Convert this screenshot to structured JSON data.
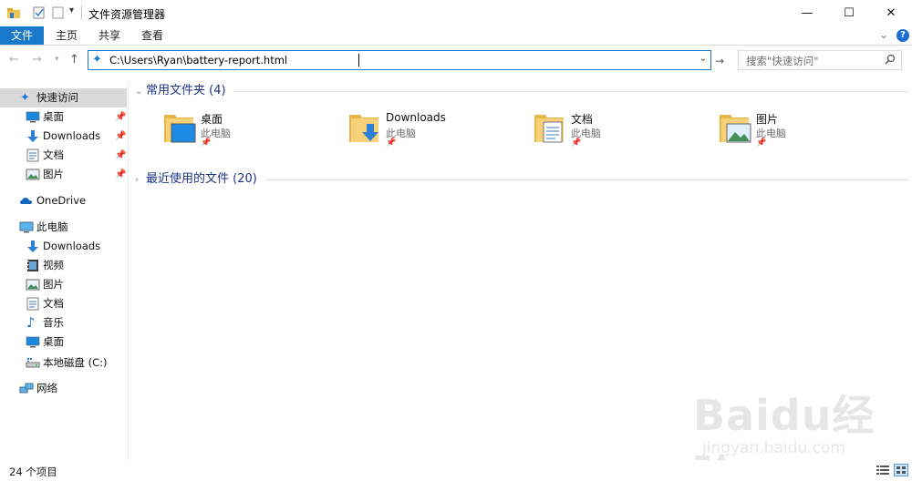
{
  "window": {
    "title": "文件资源管理器",
    "controls": {
      "minimize": "—",
      "maximize": "☐",
      "close": "✕"
    }
  },
  "ribbon": {
    "tabs": [
      "文件",
      "主页",
      "共享",
      "查看"
    ],
    "expand_chevron": "⌄",
    "help": "?"
  },
  "address": {
    "path": "C:\\Users\\Ryan\\battery-report.html",
    "dropdown": "⌄",
    "go": "→"
  },
  "search": {
    "placeholder": "搜索\"快速访问\""
  },
  "nav": {
    "quick_access": "快速访问",
    "quick_items": [
      {
        "label": "桌面",
        "icon": "desktop-icon"
      },
      {
        "label": "Downloads",
        "icon": "download-icon"
      },
      {
        "label": "文档",
        "icon": "document-icon"
      },
      {
        "label": "图片",
        "icon": "pictures-icon"
      }
    ],
    "onedrive": "OneDrive",
    "this_pc": "此电脑",
    "pc_items": [
      {
        "label": "Downloads",
        "icon": "download-icon"
      },
      {
        "label": "视频",
        "icon": "video-icon"
      },
      {
        "label": "图片",
        "icon": "pictures-icon"
      },
      {
        "label": "文档",
        "icon": "document-icon"
      },
      {
        "label": "音乐",
        "icon": "music-icon"
      },
      {
        "label": "桌面",
        "icon": "desktop-icon"
      },
      {
        "label": "本地磁盘 (C:)",
        "icon": "drive-icon"
      }
    ],
    "network": "网络"
  },
  "content": {
    "frequent_header": "常用文件夹 (4)",
    "frequent": [
      {
        "name": "桌面",
        "location": "此电脑",
        "icon": "desktop-folder-icon"
      },
      {
        "name": "Downloads",
        "location": "此电脑",
        "icon": "downloads-folder-icon"
      },
      {
        "name": "文档",
        "location": "此电脑",
        "icon": "documents-folder-icon"
      },
      {
        "name": "图片",
        "location": "此电脑",
        "icon": "pictures-folder-icon"
      }
    ],
    "recent_header": "最近使用的文件 (20)"
  },
  "status": {
    "count": "24 个项目"
  },
  "watermark": {
    "brand": "Baidu经验",
    "url": "jingyan.baidu.com"
  },
  "colors": {
    "accent": "#1979ca",
    "header_text": "#1e3287",
    "folder": "#f0c250"
  }
}
